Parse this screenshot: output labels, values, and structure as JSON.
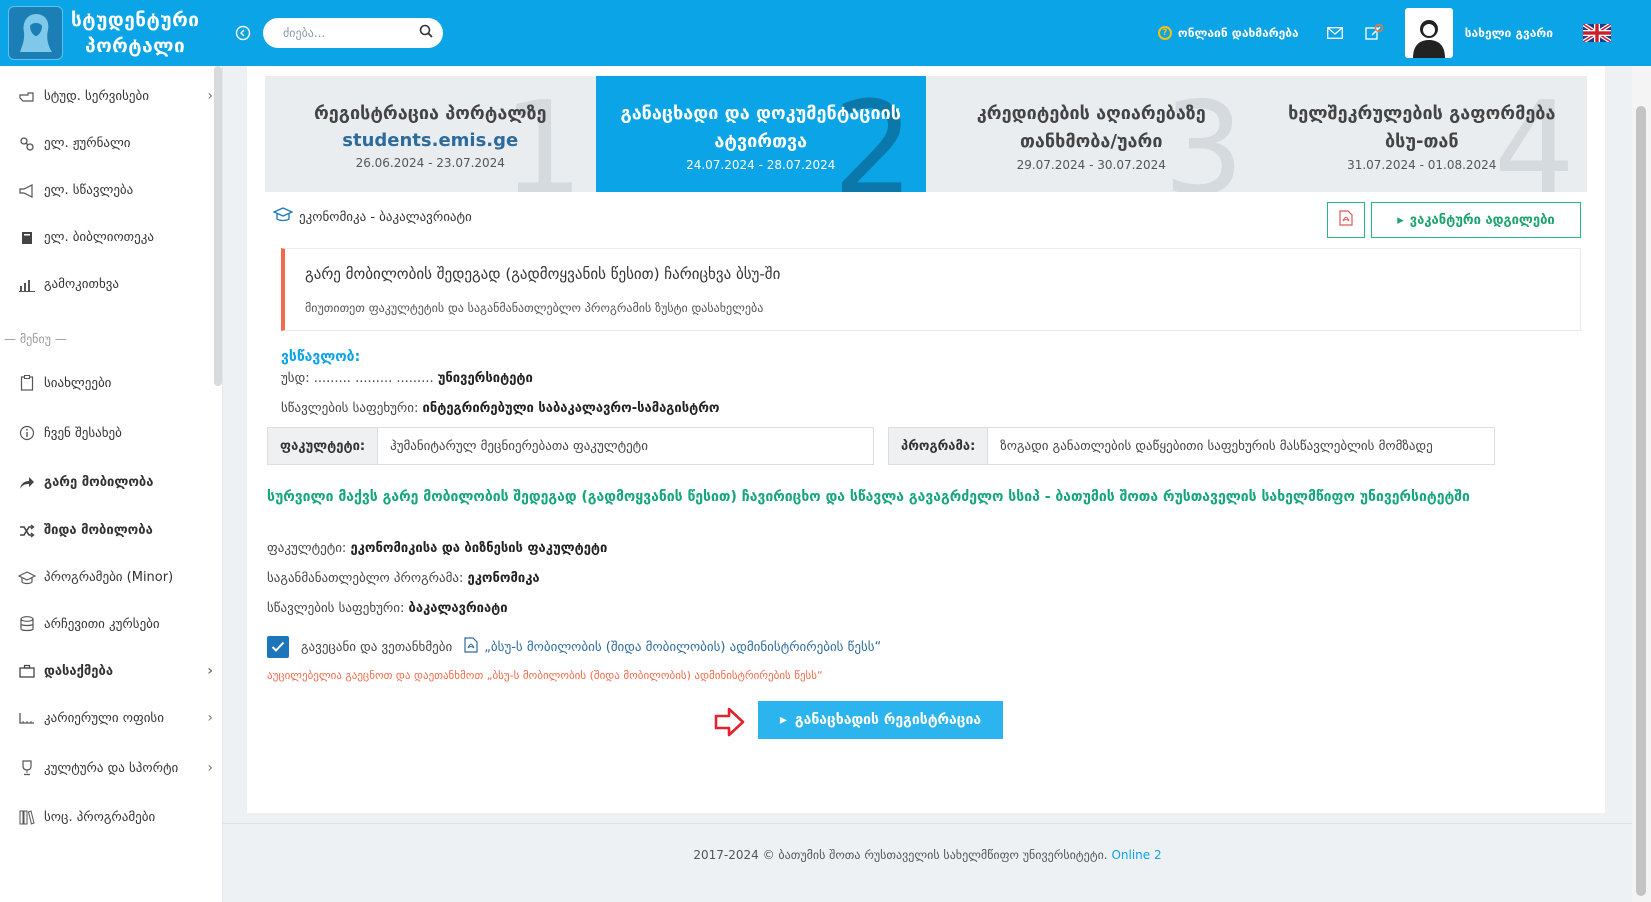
{
  "header": {
    "brand_line1": "სტუდენტური",
    "brand_line2": "პორტალი",
    "search_placeholder": "ძიება...",
    "help_label": "ონლაინ დახმარება",
    "username": "სახელი გვარი"
  },
  "sidebar": {
    "items_top": [
      {
        "label": "სტუდ. სერვისები",
        "icon": "hand-point-icon",
        "chevron": true
      },
      {
        "label": "ელ. ჟურნალი",
        "icon": "link-icon",
        "chevron": false
      },
      {
        "label": "ელ. სწავლება",
        "icon": "bullhorn-icon",
        "chevron": false
      },
      {
        "label": "ელ. ბიბლიოთეკა",
        "icon": "book-icon",
        "chevron": false
      },
      {
        "label": "გამოკითხვა",
        "icon": "bar-chart-icon",
        "chevron": false
      }
    ],
    "section_label": "— მენიუ —",
    "items_menu": [
      {
        "label": "სიახლეები",
        "icon": "clipboard-icon",
        "chevron": false,
        "bold": false
      },
      {
        "label": "ჩვენ შესახებ",
        "icon": "info-icon",
        "chevron": false,
        "bold": false
      },
      {
        "label": "გარე მობილობა",
        "icon": "share-icon",
        "chevron": false,
        "bold": true
      },
      {
        "label": "შიდა მობილობა",
        "icon": "shuffle-icon",
        "chevron": false,
        "bold": true
      },
      {
        "label": "პროგრამები (Minor)",
        "icon": "graduation-cap-icon",
        "chevron": false,
        "bold": false
      },
      {
        "label": "არჩევითი კურსები",
        "icon": "database-icon",
        "chevron": false,
        "bold": false
      },
      {
        "label": "დასაქმება",
        "icon": "briefcase-icon",
        "chevron": true,
        "bold": true
      },
      {
        "label": "კარიერული ოფისი",
        "icon": "ruler-icon",
        "chevron": true,
        "bold": false
      },
      {
        "label": "კულტურა და სპორტი",
        "icon": "trophy-icon",
        "chevron": true,
        "bold": false
      },
      {
        "label": "სოც. პროგრამები",
        "icon": "books-icon",
        "chevron": false,
        "bold": false
      }
    ]
  },
  "steps": [
    {
      "title": "რეგისტრაცია პორტალზე",
      "sub": "students.emis.ge",
      "date": "26.06.2024 - 23.07.2024",
      "num": "1",
      "active": false
    },
    {
      "title": "განაცხადი და დოკუმენტაციის ატვირთვა",
      "sub": "",
      "date": "24.07.2024 - 28.07.2024",
      "num": "2",
      "active": true
    },
    {
      "title": "კრედიტების აღიარებაზე თანხმობა/უარი",
      "sub": "",
      "date": "29.07.2024 - 30.07.2024",
      "num": "3",
      "active": false
    },
    {
      "title": "ხელშეკრულების გაფორმება ბსუ-თან",
      "sub": "",
      "date": "31.07.2024 - 01.08.2024",
      "num": "4",
      "active": false
    }
  ],
  "program_heading": "ეკონომიკა - ბაკალავრიატი",
  "vacancies_button": "ვაკანტური ადგილები",
  "info_box": {
    "heading": "გარე მობილობის შედეგად (გადმოყვანის წესით) ჩარიცხვა ბსუ-ში",
    "subtext": "მიუთითეთ ფაკულტეტის და საგანმანათლებლო პროგრამის ზუსტი დასახელება"
  },
  "current": {
    "label": "ვსწავლობ:",
    "university_key": "უსდ:",
    "university_dots": "......... ......... .........",
    "university_value": "უნივერსიტეტი",
    "level_key": "სწავლების საფეხური:",
    "level_value": "ინტეგრირებული საბაკალავრო-სამაგისტრო",
    "faculty_key": "ფაკულტეტი:",
    "faculty_value": "ჰუმანიტარულ მეცნიერებათა ფაკულტეტი",
    "program_key": "პროგრამა:",
    "program_value": "ზოგადი განათლების დაწყებითი საფეხურის მასწავლებლის მომზადე"
  },
  "target": {
    "statement": "სურვილი მაქვს გარე მობილობის შედეგად (გადმოყვანის წესით) ჩავირიცხო და სწავლა გავაგრძელო სსიპ - ბათუმის შოთა რუსთაველის სახელმწიფო უნივერსიტეტში",
    "faculty_key": "ფაკულტეტი:",
    "faculty_value": "ეკონომიკისა და ბიზნესის ფაკულტეტი",
    "program_key": "საგანმანათლებლო პროგრამა:",
    "program_value": "ეკონომიკა",
    "level_key": "სწავლების საფეხური:",
    "level_value": "ბაკალავრიატი"
  },
  "agreement": {
    "text": "გავეცანი და ვეთანხმები",
    "link": "„ბსუ-ს მობილობის (შიდა მობილობის) ადმინისტრირების წესს“",
    "warning": "აუცილებელია გაეცნოთ და დაეთანხმოთ „ბსუ-ს მობილობის (შიდა მობილობის) ადმინისტრირების წესს“"
  },
  "register_button": "განაცხადის რეგისტრაცია",
  "footer": {
    "text": "2017-2024 © ბათუმის შოთა რუსთაველის სახელმწიფო უნივერსიტეტი.",
    "version": "Online 2"
  },
  "colors": {
    "brand": "#0ba4e6",
    "active_step": "#0ba4e6",
    "green": "#16a67c",
    "warning": "#f26b4a",
    "arrow": "#e0232e"
  }
}
